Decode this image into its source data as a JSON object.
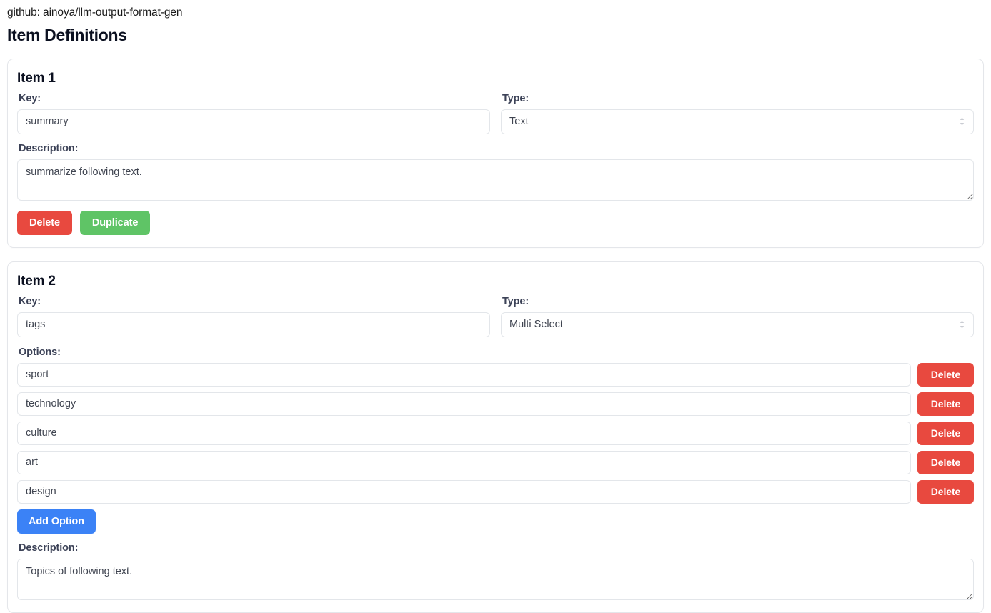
{
  "header": {
    "repo_line": "github: ainoya/llm-output-format-gen",
    "title": "Item Definitions"
  },
  "labels": {
    "key": "Key:",
    "type": "Type:",
    "description": "Description:",
    "options": "Options:"
  },
  "buttons": {
    "delete": "Delete",
    "duplicate": "Duplicate",
    "add_option": "Add Option"
  },
  "colors": {
    "delete_red": "#e8493f",
    "duplicate_green": "#5fc466",
    "add_blue": "#3b82f6",
    "border_gray": "#e3e6ea",
    "label_slate": "#3c4257"
  },
  "items": [
    {
      "title": "Item 1",
      "key_value": "summary",
      "key_placeholder": "Key",
      "type_value": "Text",
      "description_value": "summarize following text.",
      "description_placeholder": "Description"
    },
    {
      "title": "Item 2",
      "key_value": "tags",
      "key_placeholder": "Key",
      "type_value": "Multi Select",
      "description_value": "Topics of following text.",
      "description_placeholder": "Description",
      "options": [
        {
          "value": "sport",
          "delete_label": "Delete"
        },
        {
          "value": "technology",
          "delete_label": "Delete"
        },
        {
          "value": "culture",
          "delete_label": "Delete"
        },
        {
          "value": "art",
          "delete_label": "Delete"
        },
        {
          "value": "design",
          "delete_label": "Delete"
        }
      ]
    }
  ]
}
